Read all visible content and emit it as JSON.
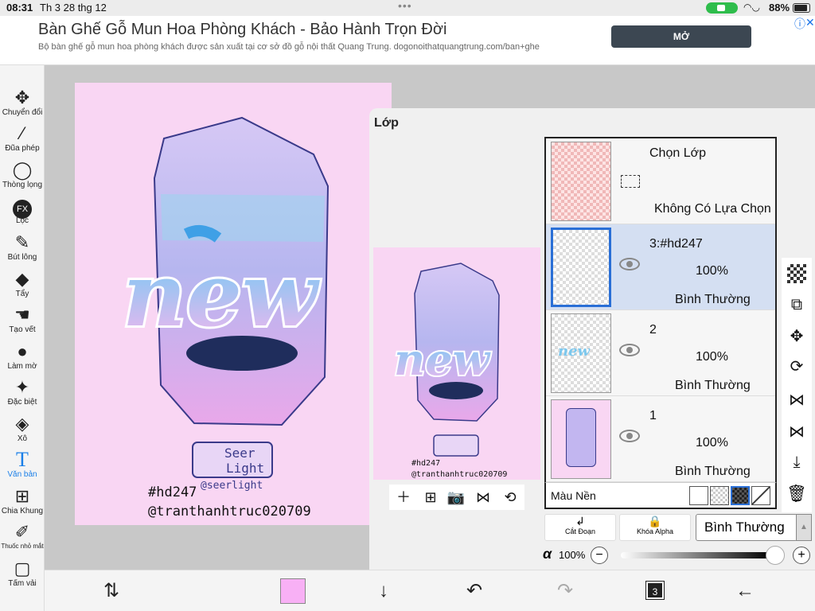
{
  "status": {
    "time": "08:31",
    "date": "Th 3 28 thg 12",
    "battery": "88%",
    "battery_level": 0.88
  },
  "ad": {
    "title": "Bàn Ghế Gỗ Mun Hoa Phòng Khách - Bảo Hành Trọn Đời",
    "desc": "Bộ bàn ghế gỗ mun hoa phòng khách được sản xuất tại cơ sở đồ gỗ nội thất Quang Trung. dogonoithatquangtrung.com/ban+ghe",
    "open_label": "MỞ",
    "info_icon": "ⓘ",
    "close_icon": "✕"
  },
  "tools": [
    {
      "label": "Chuyển đổi",
      "icon": "move-icon",
      "glyph": "✥"
    },
    {
      "label": "Đũa phép",
      "icon": "magic-wand-icon",
      "glyph": "⁄"
    },
    {
      "label": "Thòng lọng",
      "icon": "lasso-icon",
      "glyph": "◯"
    },
    {
      "label": "Lọc",
      "icon": "fx-icon",
      "glyph": "FX"
    },
    {
      "label": "Bút lông",
      "icon": "brush-icon",
      "glyph": "✎"
    },
    {
      "label": "Tẩy",
      "icon": "eraser-icon",
      "glyph": "◆"
    },
    {
      "label": "Tạo vết",
      "icon": "smudge-icon",
      "glyph": "☚"
    },
    {
      "label": "Làm mờ",
      "icon": "blur-icon",
      "glyph": "💧"
    },
    {
      "label": "Đặc biệt",
      "icon": "special-icon",
      "glyph": "✦"
    },
    {
      "label": "Xô",
      "icon": "bucket-icon",
      "glyph": "◈"
    },
    {
      "label": "Văn bản",
      "icon": "text-icon",
      "glyph": "T"
    },
    {
      "label": "Chia Khung",
      "icon": "frame-divider-icon",
      "glyph": "⊞"
    },
    {
      "label": "Thuốc nhỏ mắt",
      "icon": "eyedropper-icon",
      "glyph": "⁄"
    },
    {
      "label": "Tấm vải",
      "icon": "canvas-icon",
      "glyph": "▢"
    }
  ],
  "artwork": {
    "word": "new",
    "brand_line1": "Seer",
    "brand_line2": "Light",
    "handle": "@seerlight",
    "tag": "#hd247",
    "credit": "@tranthanhtruc020709"
  },
  "panel": {
    "title": "Lớp",
    "selection_layer": {
      "name": "Chọn Lớp",
      "status": "Không Có Lựa Chọn"
    },
    "layers": [
      {
        "name": "3:#hd247",
        "opacity": "100%",
        "mode": "Bình Thường",
        "selected": true
      },
      {
        "name": "2",
        "opacity": "100%",
        "mode": "Bình Thường",
        "selected": false
      },
      {
        "name": "1",
        "opacity": "100%",
        "mode": "Bình Thường",
        "selected": false
      }
    ],
    "background_label": "Màu Nền",
    "clip_label": "Cắt Đoạn",
    "alpha_lock_label": "Khóa Alpha",
    "blend_mode": "Bình Thường",
    "alpha_symbol": "α",
    "alpha_value": "100%",
    "alpha_level": 1.0
  },
  "preview_tools": [
    "add-layer-icon",
    "duplicate-layer-icon",
    "camera-icon",
    "flip-icon",
    "rotate-icon"
  ],
  "right_tools": [
    "checker-icon",
    "transform-icon",
    "move-icon",
    "rotate-icon",
    "flip-horizontal-icon",
    "flip-vertical-icon",
    "merge-down-icon",
    "trash-icon",
    "more-icon"
  ],
  "bottom": {
    "layer_count": "3",
    "primary_color": "#f8b0f5"
  },
  "colors": {
    "accent": "#1a7fe8",
    "canvas_bg": "#f9d6f3"
  }
}
